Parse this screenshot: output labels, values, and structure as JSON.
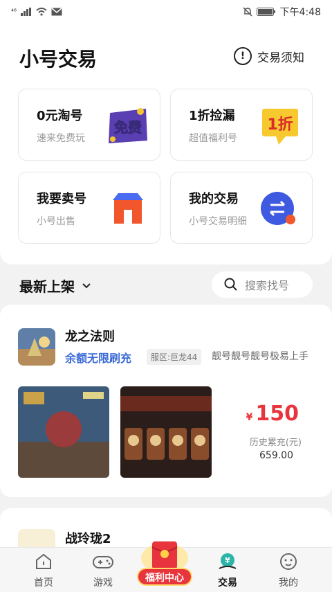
{
  "status_bar": {
    "left_text": "⁴⁶",
    "time": "下午4:48"
  },
  "header": {
    "title": "小号交易",
    "notice_label": "交易须知"
  },
  "cards": [
    {
      "title": "0元淘号",
      "subtitle": "速来免费玩",
      "icon_text": "免费"
    },
    {
      "title": "1折捡漏",
      "subtitle": "超值福利号",
      "icon_text": "1折"
    },
    {
      "title": "我要卖号",
      "subtitle": "小号出售"
    },
    {
      "title": "我的交易",
      "subtitle": "小号交易明细"
    }
  ],
  "section": {
    "title": "最新上架",
    "search_placeholder": "搜索找号"
  },
  "listings": [
    {
      "name": "龙之法则",
      "promo": "余额无限刷充",
      "server": "服区:巨龙44",
      "description": "靓号靓号靓号极易上手",
      "price_currency": "¥",
      "price": "150",
      "history_label": "历史累充(元)",
      "history_value": "659.00"
    },
    {
      "name": "战玲珑2"
    }
  ],
  "tabbar": {
    "items": [
      {
        "label": "首页"
      },
      {
        "label": "游戏"
      },
      {
        "label": "福利中心"
      },
      {
        "label": "交易"
      },
      {
        "label": "我的"
      }
    ]
  },
  "colors": {
    "accent_red": "#e8343c",
    "promo_blue": "#3b6bd8",
    "sell_orange": "#f2562c",
    "trade_blue": "#3d5ae0"
  }
}
